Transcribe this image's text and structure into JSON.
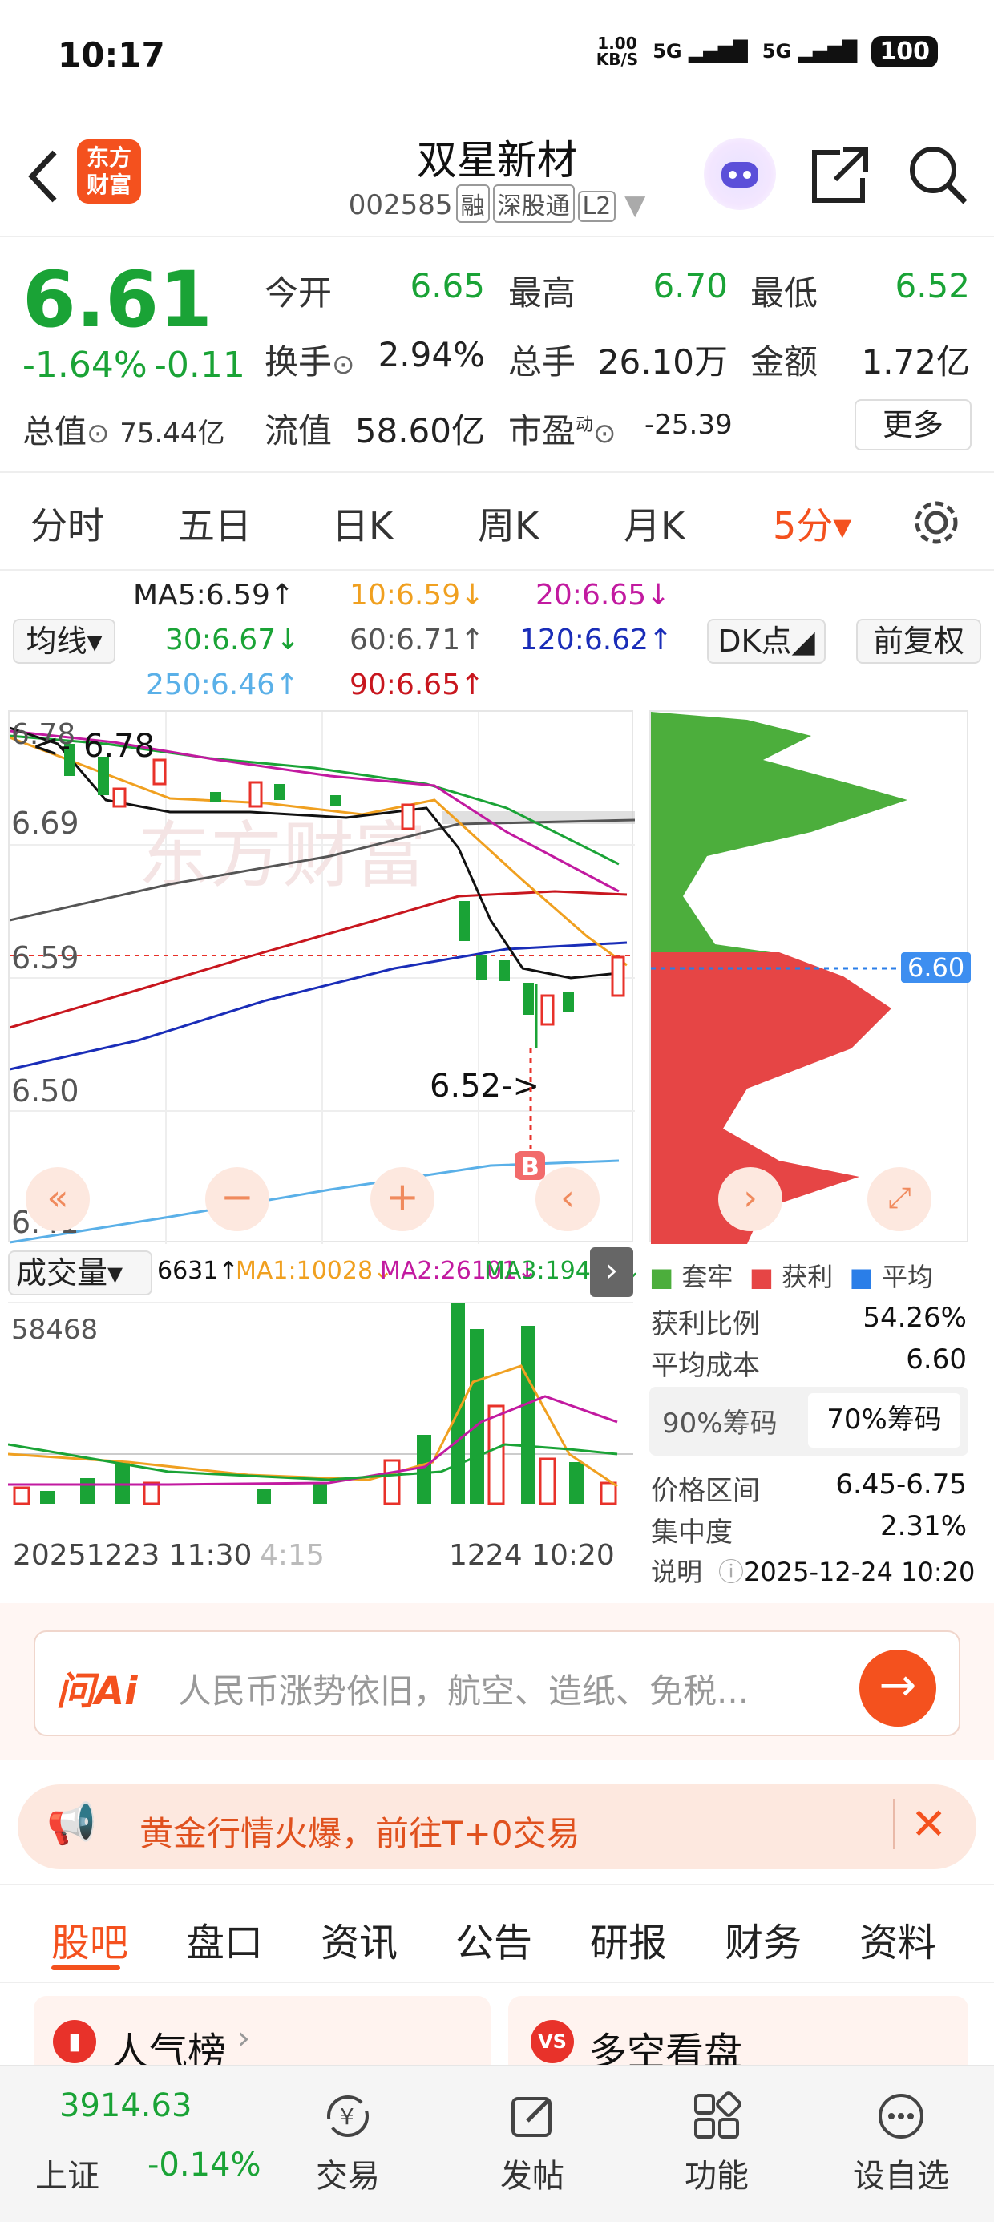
{
  "status": {
    "time": "10:17",
    "net_speed": "1.00\nKB/S",
    "sig1": "5G",
    "sig2": "5G",
    "battery": "100"
  },
  "header": {
    "title": "双星新材",
    "code": "002585",
    "tags": [
      "融",
      "深股通",
      "L2"
    ],
    "logo_text": "东方财富"
  },
  "quote": {
    "price": "6.61",
    "pct": "-1.64%",
    "chg": "-0.11",
    "open_label": "今开",
    "open": "6.65",
    "high_label": "最高",
    "high": "6.70",
    "low_label": "最低",
    "low": "6.52",
    "turnover_label": "换手",
    "turnover": "2.94%",
    "vol_label": "总手",
    "vol": "26.10万",
    "amount_label": "金额",
    "amount": "1.72亿",
    "mktcap_label": "总值",
    "mktcap": "75.44亿",
    "float_label": "流值",
    "float": "58.60亿",
    "pe_label": "市盈",
    "pe_sup": "动",
    "pe": "-25.39",
    "more": "更多"
  },
  "period_tabs": [
    "分时",
    "五日",
    "日K",
    "周K",
    "月K",
    "5分▾"
  ],
  "ma": {
    "btn": "均线▾",
    "dk": "DK点◢",
    "fq": "前复权",
    "ma5": "MA5:6.59↑",
    "ma10": "10:6.59↓",
    "ma20": "20:6.65↓",
    "ma30": "30:6.67↓",
    "ma60": "60:6.71↑",
    "ma120": "120:6.62↑",
    "ma250": "250:6.46↑",
    "ma90": "90:6.65↑"
  },
  "kchart": {
    "ytick_top": "6.78",
    "ytick1": "6.69",
    "ytick2": "6.59",
    "ytick3": "6.50",
    "ytick4": "6.41",
    "hi_note": "6.78",
    "lo_note": "6.52->",
    "buy_mark": "B",
    "watermark": "东方财富"
  },
  "vol": {
    "btn": "成交量▾",
    "v": "6631↑",
    "ma1": "MA1:10028↓",
    "ma2": "MA2:26101↓",
    "ma3": "MA3:19471↓",
    "max": "58468",
    "date_left": "20251223 11:30",
    "date_mid": "4:15",
    "date_right": "1224 10:20"
  },
  "chips": {
    "legend": [
      "套牢",
      "获利",
      "平均"
    ],
    "current": "6.60",
    "profit_ratio_label": "获利比例",
    "profit_ratio": "54.26%",
    "avg_cost_label": "平均成本",
    "avg_cost": "6.60",
    "tab90": "90%筹码",
    "tab70": "70%筹码",
    "range_label": "价格区间",
    "range": "6.45-6.75",
    "conc_label": "集中度",
    "conc": "2.31%",
    "note_label": "说明",
    "note": "2025-12-24 10:20"
  },
  "ai": {
    "logo": "问Ai",
    "placeholder": "人民币涨势依旧，航空、造纸、免税..."
  },
  "banner": {
    "text": "黄金行情火爆，前往T+0交易"
  },
  "sub_tabs": [
    "股吧",
    "盘口",
    "资讯",
    "公告",
    "研报",
    "财务",
    "资料"
  ],
  "cards": {
    "left": "人气榜",
    "right": "多空看盘"
  },
  "nav": {
    "index_value": "3914.63",
    "index_name": "上证",
    "index_pct": "-0.14%",
    "items": [
      "交易",
      "发帖",
      "功能",
      "设自选"
    ]
  },
  "colors": {
    "up": "#e8322a",
    "down": "#1aa336",
    "accent": "#f4511e",
    "ma120": "#1a2db8"
  }
}
